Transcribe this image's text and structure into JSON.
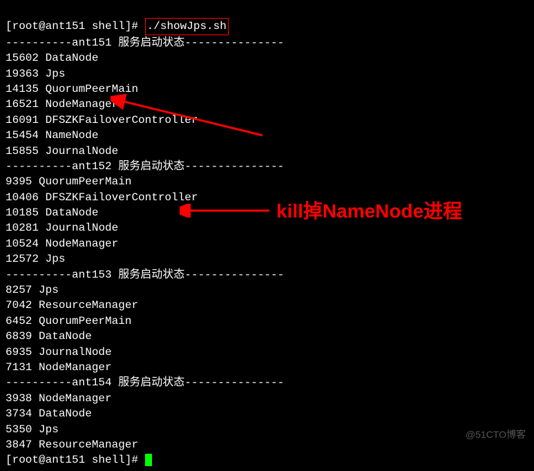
{
  "prompt1": "[root@ant151 shell]# ",
  "command": "./showJps.sh",
  "sections": [
    {
      "host": "ant151",
      "title": " 服务启动状态",
      "dashes_pre": "----------",
      "dashes_post": "---------------",
      "procs": [
        {
          "pid": "15602",
          "name": "DataNode"
        },
        {
          "pid": "19363",
          "name": "Jps"
        },
        {
          "pid": "14135",
          "name": "QuorumPeerMain"
        },
        {
          "pid": "16521",
          "name": "NodeManager"
        },
        {
          "pid": "16091",
          "name": "DFSZKFailoverController"
        },
        {
          "pid": "15454",
          "name": "NameNode"
        },
        {
          "pid": "15855",
          "name": "JournalNode"
        }
      ]
    },
    {
      "host": "ant152",
      "title": " 服务启动状态",
      "dashes_pre": "----------",
      "dashes_post": "---------------",
      "procs": [
        {
          "pid": "9395",
          "name": "QuorumPeerMain"
        },
        {
          "pid": "10406",
          "name": "DFSZKFailoverController"
        },
        {
          "pid": "10185",
          "name": "DataNode"
        },
        {
          "pid": "10281",
          "name": "JournalNode"
        },
        {
          "pid": "10524",
          "name": "NodeManager"
        },
        {
          "pid": "12572",
          "name": "Jps"
        }
      ]
    },
    {
      "host": "ant153",
      "title": " 服务启动状态",
      "dashes_pre": "----------",
      "dashes_post": "---------------",
      "procs": [
        {
          "pid": "8257",
          "name": "Jps"
        },
        {
          "pid": "7042",
          "name": "ResourceManager"
        },
        {
          "pid": "6452",
          "name": "QuorumPeerMain"
        },
        {
          "pid": "6839",
          "name": "DataNode"
        },
        {
          "pid": "6935",
          "name": "JournalNode"
        },
        {
          "pid": "7131",
          "name": "NodeManager"
        }
      ]
    },
    {
      "host": "ant154",
      "title": " 服务启动状态",
      "dashes_pre": "----------",
      "dashes_post": "---------------",
      "procs": [
        {
          "pid": "3938",
          "name": "NodeManager"
        },
        {
          "pid": "3734",
          "name": "DataNode"
        },
        {
          "pid": "5350",
          "name": "Jps"
        },
        {
          "pid": "3847",
          "name": "ResourceManager"
        }
      ]
    }
  ],
  "prompt2": "[root@ant151 shell]# ",
  "annotation_text": "kill掉NameNode进程",
  "watermark": "@51CTO博客"
}
